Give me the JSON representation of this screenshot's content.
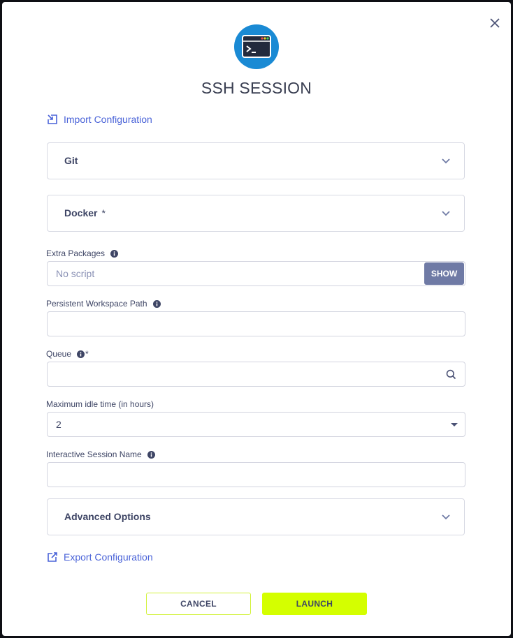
{
  "dialog": {
    "title": "SSH SESSION",
    "header_icon": "terminal-window-icon",
    "close_icon": "close-icon"
  },
  "links": {
    "import_label": "Import Configuration",
    "export_label": "Export Configuration"
  },
  "sections": {
    "git": {
      "label": "Git"
    },
    "docker": {
      "label": "Docker",
      "required_mark": "*"
    },
    "advanced": {
      "label": "Advanced Options"
    }
  },
  "fields": {
    "extra_packages": {
      "label": "Extra Packages",
      "placeholder": "No script",
      "show_label": "SHOW"
    },
    "workspace_path": {
      "label": "Persistent Workspace Path",
      "value": ""
    },
    "queue": {
      "label": "Queue",
      "required_mark": "*",
      "value": ""
    },
    "idle_time": {
      "label": "Maximum idle time (in hours)",
      "value": "2"
    },
    "session_name": {
      "label": "Interactive Session Name",
      "value": ""
    }
  },
  "buttons": {
    "cancel": "CANCEL",
    "launch": "LAUNCH"
  },
  "colors": {
    "accent": "#d4ff00",
    "link": "#4a63d8",
    "icon_bg": "#1a8ad4",
    "show_button": "#6f7aa5"
  }
}
